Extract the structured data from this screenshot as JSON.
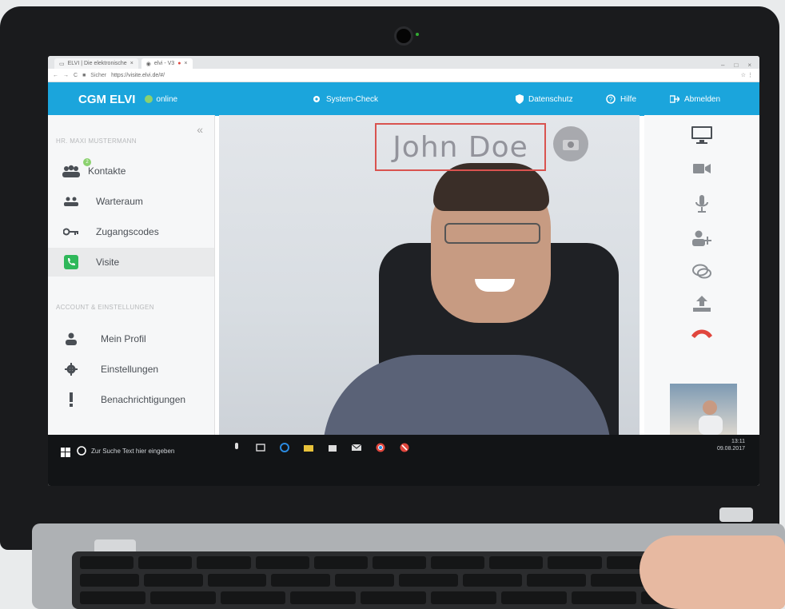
{
  "browser": {
    "tabs": [
      {
        "label": "ELVI | Die elektronische"
      },
      {
        "label": "elvi - V3"
      }
    ],
    "address": {
      "security": "Sicher",
      "url": "https://visite.elvi.de/#/"
    }
  },
  "appbar": {
    "brand": "CGM ELVI",
    "status": "online",
    "system_check": "System-Check",
    "privacy": "Datenschutz",
    "help": "Hilfe",
    "logout": "Abmelden"
  },
  "sidebar": {
    "user_name": "HR. MAXI MUSTERMANN",
    "contacts_badge": "2",
    "items": [
      {
        "label": "Kontakte"
      },
      {
        "label": "Warteraum"
      },
      {
        "label": "Zugangscodes"
      },
      {
        "label": "Visite"
      }
    ],
    "account_section": "ACCOUNT & EINSTELLUNGEN",
    "account_items": [
      {
        "label": "Mein Profil"
      },
      {
        "label": "Einstellungen"
      },
      {
        "label": "Benachrichtigungen"
      }
    ]
  },
  "video": {
    "caller_name": "John Doe"
  },
  "taskbar": {
    "search_placeholder": "Zur Suche Text hier eingeben",
    "time": "13:11",
    "date": "09.08.2017"
  },
  "colors": {
    "accent": "#1ba5dc",
    "online": "#8bd16f",
    "hangup": "#e0463d",
    "call_active": "#2fb85a"
  }
}
